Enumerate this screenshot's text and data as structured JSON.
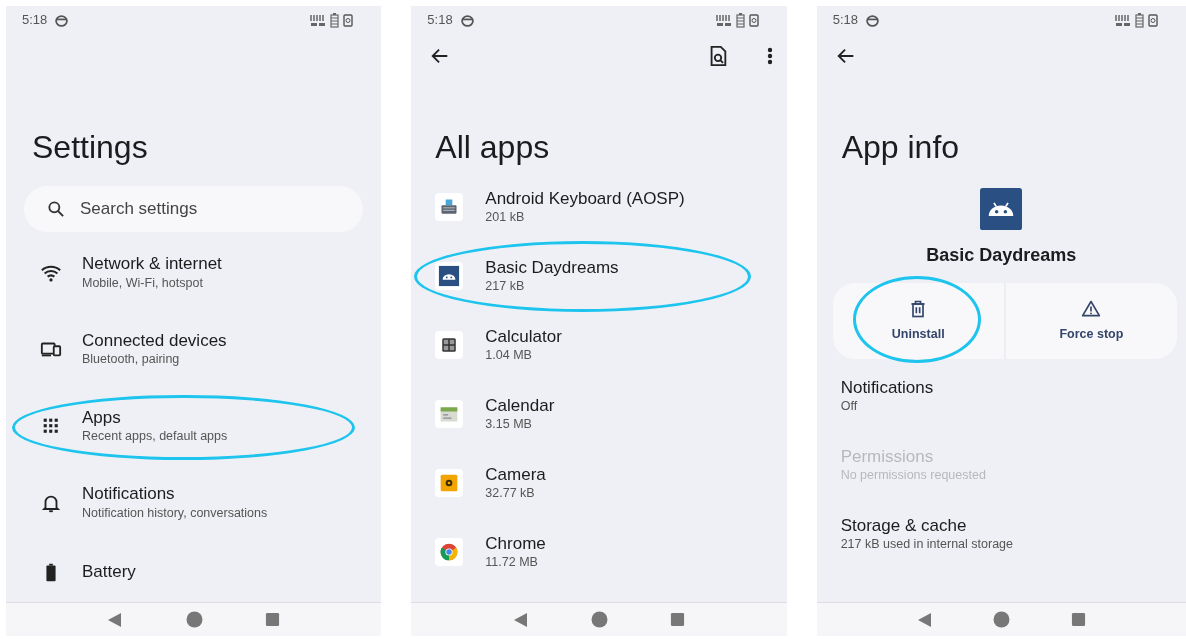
{
  "panels": [
    {
      "kind": "settings",
      "status_time": "5:18",
      "title": "Settings",
      "search": {
        "placeholder": "Search settings"
      },
      "items": [
        {
          "title": "Network & internet",
          "subtitle": "Mobile, Wi-Fi, hotspot",
          "highlighted": false
        },
        {
          "title": "Connected devices",
          "subtitle": "Bluetooth, pairing",
          "highlighted": false
        },
        {
          "title": "Apps",
          "subtitle": "Recent apps, default apps",
          "highlighted": true
        },
        {
          "title": "Notifications",
          "subtitle": "Notification history, conversations",
          "highlighted": false
        },
        {
          "title": "Battery",
          "highlighted": false
        }
      ]
    },
    {
      "kind": "app_list",
      "status_time": "5:18",
      "title": "All apps",
      "items": [
        {
          "title": "Android Keyboard (AOSP)",
          "subtitle": "201 kB",
          "highlighted": false
        },
        {
          "title": "Basic Daydreams",
          "subtitle": "217 kB",
          "highlighted": true
        },
        {
          "title": "Calculator",
          "subtitle": "1.04 MB",
          "highlighted": false
        },
        {
          "title": "Calendar",
          "subtitle": "3.15 MB",
          "highlighted": false
        },
        {
          "title": "Camera",
          "subtitle": "32.77 kB",
          "highlighted": false
        },
        {
          "title": "Chrome",
          "subtitle": "11.72 MB",
          "highlighted": false
        }
      ]
    },
    {
      "kind": "app_info",
      "status_time": "5:18",
      "title": "App info",
      "app_name": "Basic Daydreams",
      "actions": [
        {
          "label": "Uninstall",
          "highlighted": true
        },
        {
          "label": "Force stop",
          "highlighted": false
        }
      ],
      "items": [
        {
          "title": "Notifications",
          "subtitle": "Off",
          "disabled": false
        },
        {
          "title": "Permissions",
          "subtitle": "No permissions requested",
          "disabled": true
        },
        {
          "title": "Storage & cache",
          "subtitle": "217 kB used in internal storage",
          "disabled": false
        }
      ]
    }
  ]
}
